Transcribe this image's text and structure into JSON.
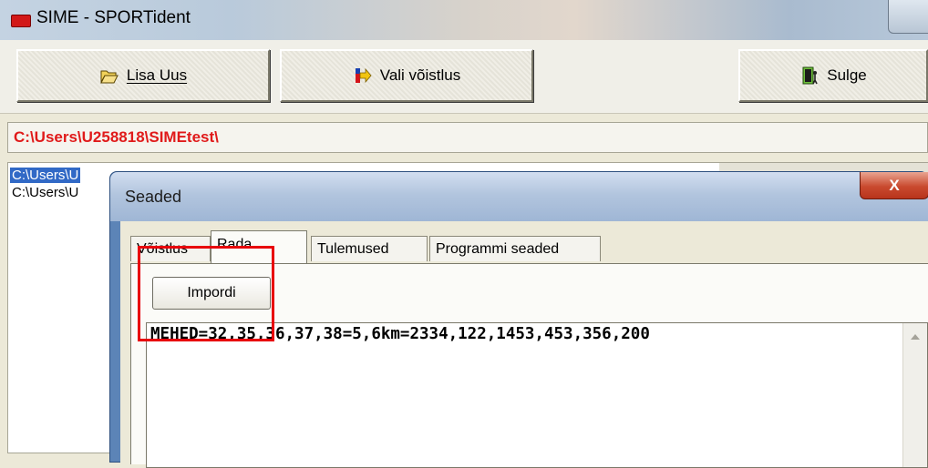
{
  "window": {
    "title": "SIME - SPORTident",
    "icon": "sportident-app-icon"
  },
  "toolbar": {
    "add_new_label": "Lisa Uus",
    "add_new_icon": "folder-open-icon",
    "select_competition_label": "Vali võistlus",
    "select_competition_icon": "arrow-right-icon",
    "close_label": "Sulge",
    "close_icon": "exit-door-icon"
  },
  "path": {
    "current": "C:\\Users\\U258818\\SIMEtest\\",
    "color": "#e01a1a"
  },
  "list": {
    "items": [
      {
        "label": "C:\\Users\\U",
        "selected": true
      },
      {
        "label": "C:\\Users\\U",
        "selected": false
      }
    ]
  },
  "dialog": {
    "title": "Seaded",
    "close_glyph": "X",
    "tabs": [
      {
        "label": "Võistlus",
        "active": false
      },
      {
        "label": "Rada",
        "active": true
      },
      {
        "label": "Tulemused",
        "active": false
      },
      {
        "label": "Programmi seaded",
        "active": false
      }
    ],
    "import_button_label": "Impordi",
    "editor_text": "MEHED=32,35,36,37,38=5,6km=2334,122,1453,453,356,200"
  },
  "colors": {
    "highlight": "#e8000b",
    "selection": "#3169c6"
  }
}
